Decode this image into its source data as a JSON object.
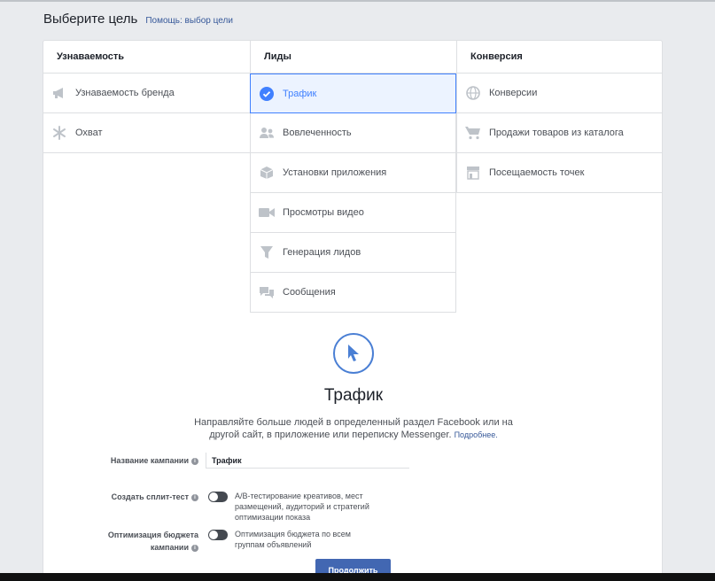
{
  "header": {
    "title": "Выберите цель",
    "help": "Помощь: выбор цели"
  },
  "columns": [
    {
      "title": "Узнаваемость",
      "items": [
        {
          "label": "Узнаваемость бренда",
          "icon": "megaphone-icon"
        },
        {
          "label": "Охват",
          "icon": "snowflake-icon"
        }
      ]
    },
    {
      "title": "Лиды",
      "items": [
        {
          "label": "Трафик",
          "icon": "checkmark-icon",
          "selected": true
        },
        {
          "label": "Вовлеченность",
          "icon": "people-icon"
        },
        {
          "label": "Установки приложения",
          "icon": "box-icon"
        },
        {
          "label": "Просмотры видео",
          "icon": "video-camera-icon"
        },
        {
          "label": "Генерация лидов",
          "icon": "funnel-icon"
        },
        {
          "label": "Сообщения",
          "icon": "chat-bubbles-icon"
        }
      ]
    },
    {
      "title": "Конверсия",
      "items": [
        {
          "label": "Конверсии",
          "icon": "globe-icon"
        },
        {
          "label": "Продажи товаров из каталога",
          "icon": "cart-icon"
        },
        {
          "label": "Посещаемость точек",
          "icon": "store-icon"
        }
      ]
    }
  ],
  "detail": {
    "icon": "cursor-icon",
    "title": "Трафик",
    "description": "Направляйте больше людей в определенный раздел Facebook или на другой сайт, в приложение или переписку Messenger.",
    "more_link": "Подробнее."
  },
  "form": {
    "campaign_name_label": "Название кампании",
    "campaign_name_value": "Трафик",
    "split_test_label": "Создать сплит-тест",
    "split_test_desc": "A/B-тестирование креативов, мест размещений, аудиторий и стратегий оптимизации показа",
    "budget_label": "Оптимизация бюджета кампании",
    "budget_desc": "Оптимизация бюджета по всем группам объявлений",
    "continue_button": "Продолжить"
  },
  "colors": {
    "accent": "#4080ff",
    "selected_bg": "#ecf3ff",
    "button": "#4267b2",
    "icon": "#bec3c9"
  }
}
